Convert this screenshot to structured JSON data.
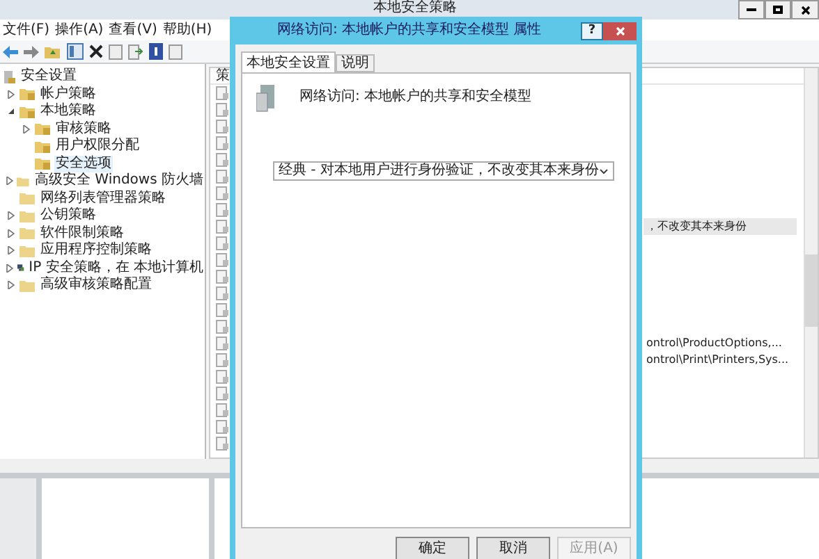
{
  "main_window": {
    "title": "本地安全策略"
  },
  "menu": [
    "文件(F)",
    "操作(A)",
    "查看(V)",
    "帮助(H)"
  ],
  "tree": {
    "label": "安全设置",
    "children": [
      {
        "label": "帐户策略",
        "kind": "policy-folder",
        "expanded": false,
        "selected": false
      },
      {
        "label": "本地策略",
        "kind": "policy-folder",
        "expanded": true,
        "selected": false,
        "children": [
          {
            "label": "审核策略",
            "kind": "policy-folder",
            "expanded": false,
            "selected": false
          },
          {
            "label": "用户权限分配",
            "kind": "policy-folder",
            "selected": false
          },
          {
            "label": "安全选项",
            "kind": "policy-folder",
            "selected": true
          }
        ]
      },
      {
        "label": "高级安全 Windows 防火墙",
        "kind": "folder",
        "expanded": false,
        "selected": false
      },
      {
        "label": "网络列表管理器策略",
        "kind": "folder",
        "selected": false
      },
      {
        "label": "公钥策略",
        "kind": "folder",
        "expanded": false,
        "selected": false
      },
      {
        "label": "软件限制策略",
        "kind": "folder",
        "expanded": false,
        "selected": false
      },
      {
        "label": "应用程序控制策略",
        "kind": "folder",
        "expanded": false,
        "selected": false
      },
      {
        "label": "IP 安全策略，在 本地计算机",
        "kind": "computer",
        "expanded": false,
        "selected": false
      },
      {
        "label": "高级审核策略配置",
        "kind": "folder",
        "expanded": false,
        "selected": false
      }
    ]
  },
  "list": {
    "column_1": "策",
    "rows": [
      {
        "selected": true,
        "setting": "，不改变其本来身份"
      },
      {
        "selected": false,
        "setting": "ontrol\\ProductOptions,..."
      },
      {
        "selected": false,
        "setting": "ontrol\\Print\\Printers,Sys..."
      }
    ]
  },
  "dialog": {
    "title": "网络访问: 本地帐户的共享和安全模型 属性",
    "help_button": "?",
    "tabs": [
      {
        "label": "本地安全设置",
        "selected": true
      },
      {
        "label": "说明",
        "selected": false
      }
    ],
    "policy_name": "网络访问: 本地帐户的共享和安全模型",
    "dropdown": {
      "value": "经典 - 对本地用户进行身份验证，不改变其本来身份"
    },
    "buttons": [
      {
        "label": "确定",
        "disabled": false
      },
      {
        "label": "取消",
        "disabled": false
      },
      {
        "label": "应用(A)",
        "disabled": true
      }
    ]
  }
}
